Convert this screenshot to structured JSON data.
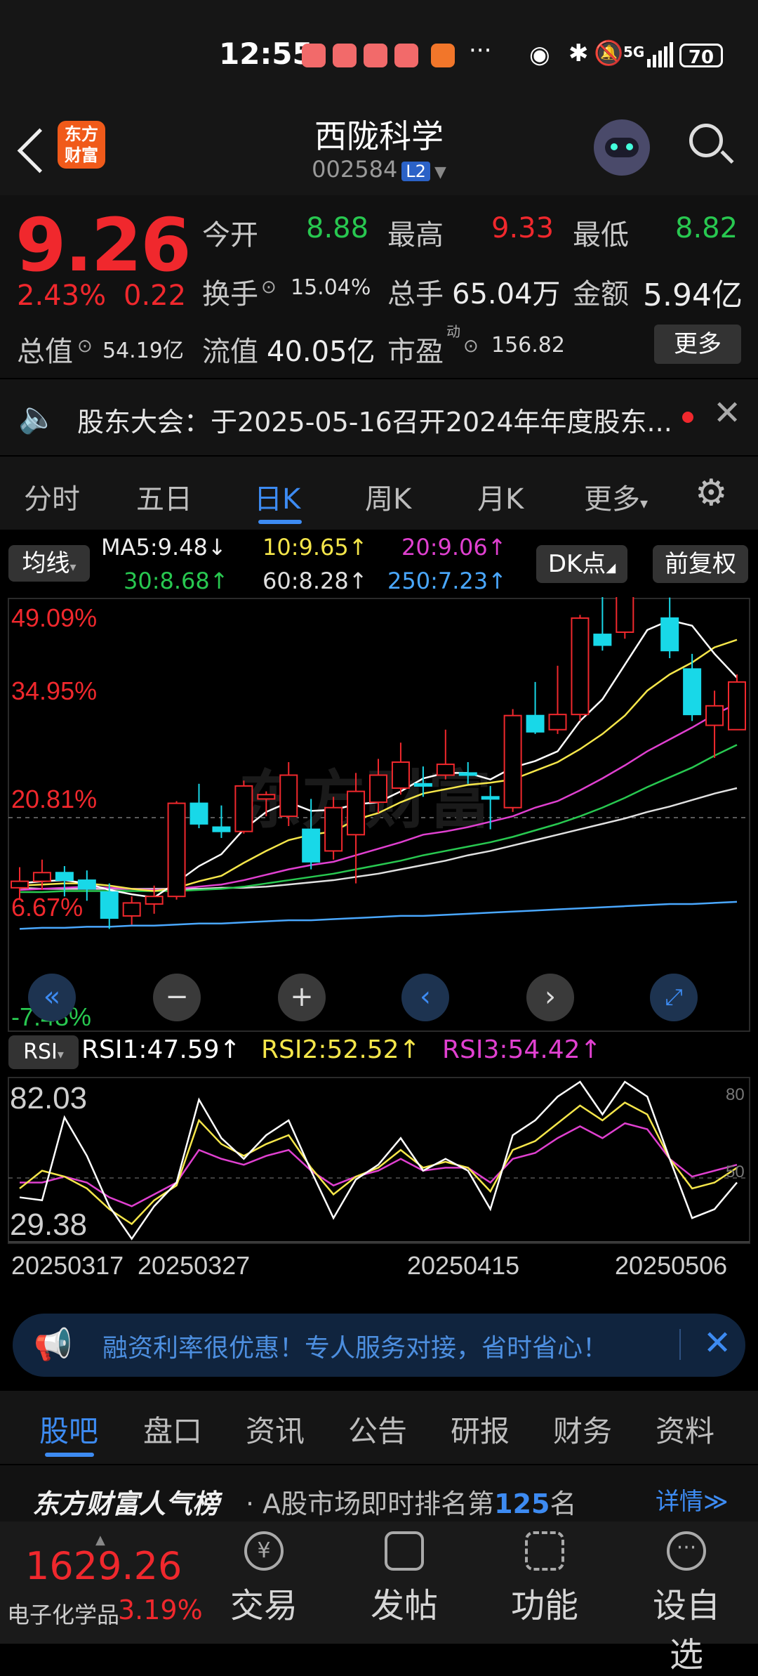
{
  "status": {
    "time": "12:55",
    "battery": "70",
    "network": "5G"
  },
  "header": {
    "title": "西陇科学",
    "code": "002584",
    "level": "L2"
  },
  "quote": {
    "price": "9.26",
    "change_pct": "2.43%",
    "change": "0.22",
    "open_label": "今开",
    "open": "8.88",
    "high_label": "最高",
    "high": "9.33",
    "low_label": "最低",
    "low": "8.82",
    "turnover_label": "换手",
    "turnover": "15.04%",
    "volume_label": "总手",
    "volume": "65.04万",
    "amount_label": "金额",
    "amount": "5.94亿",
    "mktcap_label": "总值",
    "mktcap": "54.19亿",
    "float_label": "流值",
    "float": "40.05亿",
    "pe_label": "市盈",
    "pe_sup": "动",
    "pe": "156.82",
    "more": "更多"
  },
  "notice": {
    "text": "股东大会：于2025-05-16召开2024年年度股东..."
  },
  "tabs": [
    "分时",
    "五日",
    "日K",
    "周K",
    "月K",
    "更多"
  ],
  "active_tab": "日K",
  "chart_controls": {
    "ma_toggle": "均线",
    "dk": "DK点",
    "adjust": "前复权",
    "rsi_toggle": "RSI"
  },
  "ma": {
    "ma5": "MA5:9.48",
    "ma10": "10:9.65",
    "ma20": "20:9.06",
    "ma30": "30:8.68",
    "ma60": "60:8.28",
    "ma250": "250:7.23"
  },
  "rsi_values": {
    "rsi1": "RSI1:47.59",
    "rsi2": "RSI2:52.52",
    "rsi3": "RSI3:54.42"
  },
  "chart_labels": {
    "y1": "49.09%",
    "y2": "34.95%",
    "y3": "20.81%",
    "y4": "6.67%",
    "y5": "-7.48%",
    "rsi_top": "82.03",
    "rsi_bot": "29.38",
    "rsi_r80": "80",
    "rsi_r50": "50"
  },
  "dates": [
    "20250317",
    "20250327",
    "20250415",
    "20250506"
  ],
  "watermark": "东方财富",
  "chart_data": {
    "type": "candlestick",
    "y_axis_pct": [
      -7.48,
      6.67,
      20.81,
      34.95,
      49.09
    ],
    "candles": [
      {
        "o": 7.36,
        "h": 7.55,
        "l": 7.26,
        "c": 7.42
      },
      {
        "o": 7.42,
        "h": 7.62,
        "l": 7.34,
        "c": 7.5
      },
      {
        "o": 7.5,
        "h": 7.56,
        "l": 7.28,
        "c": 7.43
      },
      {
        "o": 7.43,
        "h": 7.52,
        "l": 7.24,
        "c": 7.35
      },
      {
        "o": 7.32,
        "h": 7.4,
        "l": 6.98,
        "c": 7.08
      },
      {
        "o": 7.1,
        "h": 7.28,
        "l": 7.02,
        "c": 7.22
      },
      {
        "o": 7.21,
        "h": 7.38,
        "l": 7.12,
        "c": 7.28
      },
      {
        "o": 7.28,
        "h": 8.16,
        "l": 7.25,
        "c": 8.14
      },
      {
        "o": 8.14,
        "h": 8.32,
        "l": 7.91,
        "c": 7.95
      },
      {
        "o": 7.92,
        "h": 8.12,
        "l": 7.82,
        "c": 7.88
      },
      {
        "o": 7.88,
        "h": 8.35,
        "l": 7.86,
        "c": 8.3
      },
      {
        "o": 8.18,
        "h": 8.25,
        "l": 8.02,
        "c": 8.22
      },
      {
        "o": 8.02,
        "h": 8.52,
        "l": 7.93,
        "c": 8.4
      },
      {
        "o": 7.9,
        "h": 8.18,
        "l": 7.53,
        "c": 7.6
      },
      {
        "o": 7.7,
        "h": 8.2,
        "l": 7.62,
        "c": 8.1
      },
      {
        "o": 7.85,
        "h": 8.42,
        "l": 7.4,
        "c": 8.25
      },
      {
        "o": 8.15,
        "h": 8.55,
        "l": 8.05,
        "c": 8.4
      },
      {
        "o": 8.28,
        "h": 8.7,
        "l": 8.22,
        "c": 8.52
      },
      {
        "o": 8.32,
        "h": 8.48,
        "l": 8.2,
        "c": 8.3
      },
      {
        "o": 8.4,
        "h": 8.82,
        "l": 8.36,
        "c": 8.5
      },
      {
        "o": 8.42,
        "h": 8.52,
        "l": 8.32,
        "c": 8.4
      },
      {
        "o": 8.2,
        "h": 8.3,
        "l": 7.9,
        "c": 8.18
      },
      {
        "o": 8.1,
        "h": 9.01,
        "l": 8.06,
        "c": 8.95
      },
      {
        "o": 8.95,
        "h": 9.26,
        "l": 8.78,
        "c": 8.8
      },
      {
        "o": 8.82,
        "h": 9.41,
        "l": 8.78,
        "c": 8.96
      },
      {
        "o": 8.96,
        "h": 9.88,
        "l": 8.9,
        "c": 9.85
      },
      {
        "o": 9.7,
        "h": 10.1,
        "l": 9.55,
        "c": 9.6
      },
      {
        "o": 9.72,
        "h": 10.34,
        "l": 9.66,
        "c": 10.3
      },
      {
        "o": 10.28,
        "h": 10.81,
        "l": 10.11,
        "c": 10.18
      },
      {
        "o": 9.85,
        "h": 10.04,
        "l": 9.48,
        "c": 9.55
      },
      {
        "o": 9.38,
        "h": 9.52,
        "l": 8.9,
        "c": 8.96
      },
      {
        "o": 8.86,
        "h": 9.18,
        "l": 8.56,
        "c": 9.04
      },
      {
        "o": 8.82,
        "h": 9.33,
        "l": 8.82,
        "c": 9.26
      }
    ],
    "ma5": [
      7.4,
      7.42,
      7.43,
      7.4,
      7.34,
      7.3,
      7.27,
      7.41,
      7.56,
      7.67,
      7.9,
      8.06,
      8.15,
      8.07,
      8.08,
      8.13,
      8.15,
      8.25,
      8.37,
      8.42,
      8.42,
      8.36,
      8.47,
      8.53,
      8.62,
      8.9,
      9.1,
      9.42,
      9.74,
      9.83,
      9.78,
      9.52,
      9.3
    ],
    "ma10": [
      7.38,
      7.39,
      7.4,
      7.4,
      7.38,
      7.35,
      7.33,
      7.36,
      7.42,
      7.47,
      7.59,
      7.7,
      7.8,
      7.85,
      7.88,
      7.99,
      8.05,
      8.15,
      8.23,
      8.27,
      8.31,
      8.33,
      8.36,
      8.44,
      8.52,
      8.64,
      8.78,
      8.95,
      9.18,
      9.33,
      9.44,
      9.58,
      9.65
    ],
    "ma20": [
      7.34,
      7.35,
      7.36,
      7.37,
      7.36,
      7.35,
      7.34,
      7.35,
      7.37,
      7.39,
      7.43,
      7.48,
      7.53,
      7.57,
      7.6,
      7.66,
      7.72,
      7.78,
      7.85,
      7.88,
      7.92,
      7.97,
      8.02,
      8.1,
      8.16,
      8.26,
      8.37,
      8.49,
      8.62,
      8.73,
      8.84,
      8.96,
      9.06
    ],
    "ma30": [
      7.32,
      7.32,
      7.33,
      7.33,
      7.33,
      7.33,
      7.33,
      7.33,
      7.34,
      7.35,
      7.37,
      7.4,
      7.43,
      7.46,
      7.49,
      7.53,
      7.57,
      7.61,
      7.66,
      7.7,
      7.74,
      7.78,
      7.83,
      7.89,
      7.95,
      8.02,
      8.1,
      8.19,
      8.29,
      8.38,
      8.47,
      8.58,
      8.68
    ],
    "ma60": [
      7.36,
      7.35,
      7.35,
      7.35,
      7.35,
      7.35,
      7.35,
      7.35,
      7.35,
      7.36,
      7.36,
      7.37,
      7.39,
      7.41,
      7.43,
      7.46,
      7.49,
      7.53,
      7.57,
      7.61,
      7.66,
      7.7,
      7.75,
      7.8,
      7.85,
      7.9,
      7.95,
      8.0,
      8.06,
      8.11,
      8.17,
      8.23,
      8.28
    ],
    "ma250": [
      6.98,
      6.99,
      6.99,
      7.0,
      7.0,
      7.01,
      7.01,
      7.02,
      7.03,
      7.03,
      7.04,
      7.05,
      7.06,
      7.06,
      7.07,
      7.08,
      7.09,
      7.1,
      7.1,
      7.11,
      7.12,
      7.13,
      7.14,
      7.15,
      7.16,
      7.17,
      7.18,
      7.19,
      7.2,
      7.21,
      7.21,
      7.22,
      7.23
    ],
    "rsi1": [
      43,
      42,
      70,
      57,
      40,
      29,
      40,
      48,
      76,
      63,
      56,
      64,
      69,
      52,
      36,
      49,
      54,
      63,
      52,
      56,
      52,
      39,
      64,
      69,
      77,
      82,
      71,
      82,
      77,
      56,
      36,
      39,
      48
    ],
    "rsi2": [
      46,
      52,
      50,
      46,
      39,
      34,
      42,
      47,
      69,
      61,
      57,
      61,
      64,
      53,
      44,
      50,
      53,
      59,
      53,
      55,
      53,
      45,
      59,
      62,
      68,
      74,
      69,
      75,
      71,
      56,
      46,
      48,
      53
    ],
    "rsi3": [
      48,
      48,
      50,
      48,
      43,
      40,
      44,
      48,
      59,
      56,
      54,
      57,
      59,
      52,
      47,
      50,
      52,
      56,
      52,
      53,
      53,
      48,
      56,
      58,
      63,
      67,
      63,
      68,
      66,
      56,
      50,
      52,
      54
    ],
    "rsi_range": [
      29.38,
      82.03
    ]
  },
  "banner": {
    "text": "融资利率很优惠！专人服务对接，省时省心！"
  },
  "bottom_tabs": [
    "股吧",
    "盘口",
    "资讯",
    "公告",
    "研报",
    "财务",
    "资料"
  ],
  "rank": {
    "brand": "东方财富人气榜",
    "prefix": "· A股市场即时排名第",
    "num": "125",
    "suffix": "名",
    "detail": "详情"
  },
  "index": {
    "value": "1629.26",
    "name": "电子化学品",
    "change": "3.19%"
  },
  "footer": {
    "trade": "交易",
    "post": "发帖",
    "func": "功能",
    "watch": "设自选"
  },
  "colors": {
    "up": "#f0282d",
    "down": "#18d8e8",
    "accent": "#3d8bf2",
    "ma5": "#ffffff",
    "ma10": "#f5e64a",
    "ma20": "#e040d0",
    "ma30": "#28c850",
    "ma60": "#e0e0e0",
    "ma250": "#4aa8ff"
  }
}
